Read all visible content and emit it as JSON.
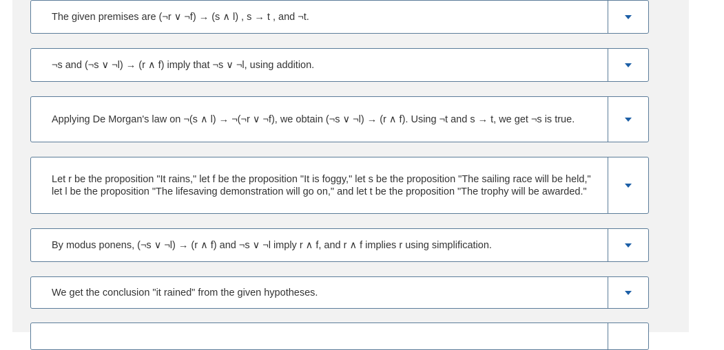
{
  "rows": [
    {
      "text": "The given premises are (¬r ∨ ¬f) → (s ∧ l) , s → t , and ¬t."
    },
    {
      "text": "¬s and (¬s ∨ ¬l) → (r ∧ f) imply that ¬s ∨ ¬l, using addition."
    },
    {
      "text": "Applying De Morgan's law on ¬(s ∧ l) → ¬(¬r ∨ ¬f), we obtain (¬s ∨ ¬l) → (r ∧ f). Using ¬t and s → t, we get ¬s is true."
    },
    {
      "text": "Let r be the proposition \"It rains,\" let f be the proposition \"It is foggy,\" let s be the proposition \"The sailing race will be held,\" let l be the proposition \"The lifesaving demonstration will go on,\" and let t be the proposition \"The trophy will be awarded.\""
    },
    {
      "text": "By modus ponens,  (¬s ∨ ¬l) → (r ∧ f) and ¬s ∨ ¬l imply r ∧ f, and r ∧ f implies r using simplification."
    },
    {
      "text": "We get the conclusion \"it rained\" from the given hypotheses."
    },
    {
      "text": ""
    }
  ],
  "dropdown_icon": "caret-down-icon"
}
